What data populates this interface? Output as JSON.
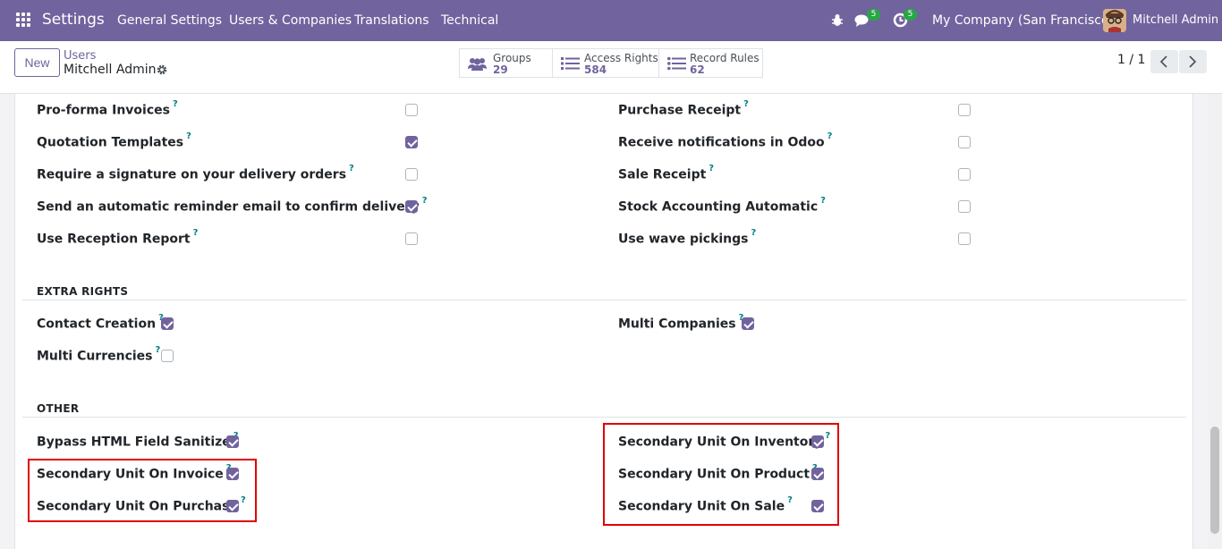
{
  "navbar": {
    "brand": "Settings",
    "menus": [
      "General Settings",
      "Users & Companies",
      "Translations",
      "Technical"
    ],
    "messages_badge": "5",
    "activities_badge": "5",
    "company": "My Company (San Francisco)",
    "user": "Mitchell Admin"
  },
  "control_panel": {
    "new_label": "New",
    "breadcrumb_parent": "Users",
    "breadcrumb_current": "Mitchell Admin",
    "smart_buttons": [
      {
        "label": "Groups",
        "count": "29"
      },
      {
        "label": "Access Rights",
        "count": "584"
      },
      {
        "label": "Record Rules",
        "count": "62"
      }
    ],
    "pager": "1 / 1"
  },
  "rights_left": [
    {
      "label": "Pro-forma Invoices",
      "tooltip": "?",
      "checked": false
    },
    {
      "label": "Quotation Templates",
      "tooltip": "?",
      "checked": true
    },
    {
      "label": "Require a signature on your delivery orders",
      "tooltip": "?",
      "checked": false
    },
    {
      "label": "Send an automatic reminder email to confirm delivery",
      "tooltip": "?",
      "checked": true
    },
    {
      "label": "Use Reception Report",
      "tooltip": "?",
      "checked": false
    }
  ],
  "rights_right": [
    {
      "label": "Purchase Receipt",
      "tooltip": "?",
      "checked": false
    },
    {
      "label": "Receive notifications in Odoo",
      "tooltip": "?",
      "checked": false
    },
    {
      "label": "Sale Receipt",
      "tooltip": "?",
      "checked": false
    },
    {
      "label": "Stock Accounting Automatic",
      "tooltip": "?",
      "checked": false
    },
    {
      "label": "Use wave pickings",
      "tooltip": "?",
      "checked": false
    }
  ],
  "extra_rights": {
    "title": "EXTRA RIGHTS",
    "contact_creation": {
      "label": "Contact Creation",
      "tooltip": "?",
      "checked": true
    },
    "multi_currencies": {
      "label": "Multi Currencies",
      "tooltip": "?",
      "checked": false
    },
    "multi_companies": {
      "label": "Multi Companies",
      "tooltip": "?",
      "checked": true
    }
  },
  "other": {
    "title": "OTHER",
    "left": [
      {
        "label": "Bypass HTML Field Sanitize",
        "tooltip": "?",
        "checked": true
      },
      {
        "label": "Secondary Unit On Invoice",
        "tooltip": "?",
        "checked": true
      },
      {
        "label": "Secondary Unit On Purchase",
        "tooltip": "?",
        "checked": true
      }
    ],
    "right": [
      {
        "label": "Secondary Unit On Inventory",
        "tooltip": "?",
        "checked": true
      },
      {
        "label": "Secondary Unit On Product",
        "tooltip": "?",
        "checked": true
      },
      {
        "label": "Secondary Unit On Sale",
        "tooltip": "?",
        "checked": true
      }
    ]
  },
  "colors": {
    "brand": "#71639e",
    "tooltip": "#017e84",
    "highlight": "#e00000",
    "badge": "#28a745"
  }
}
